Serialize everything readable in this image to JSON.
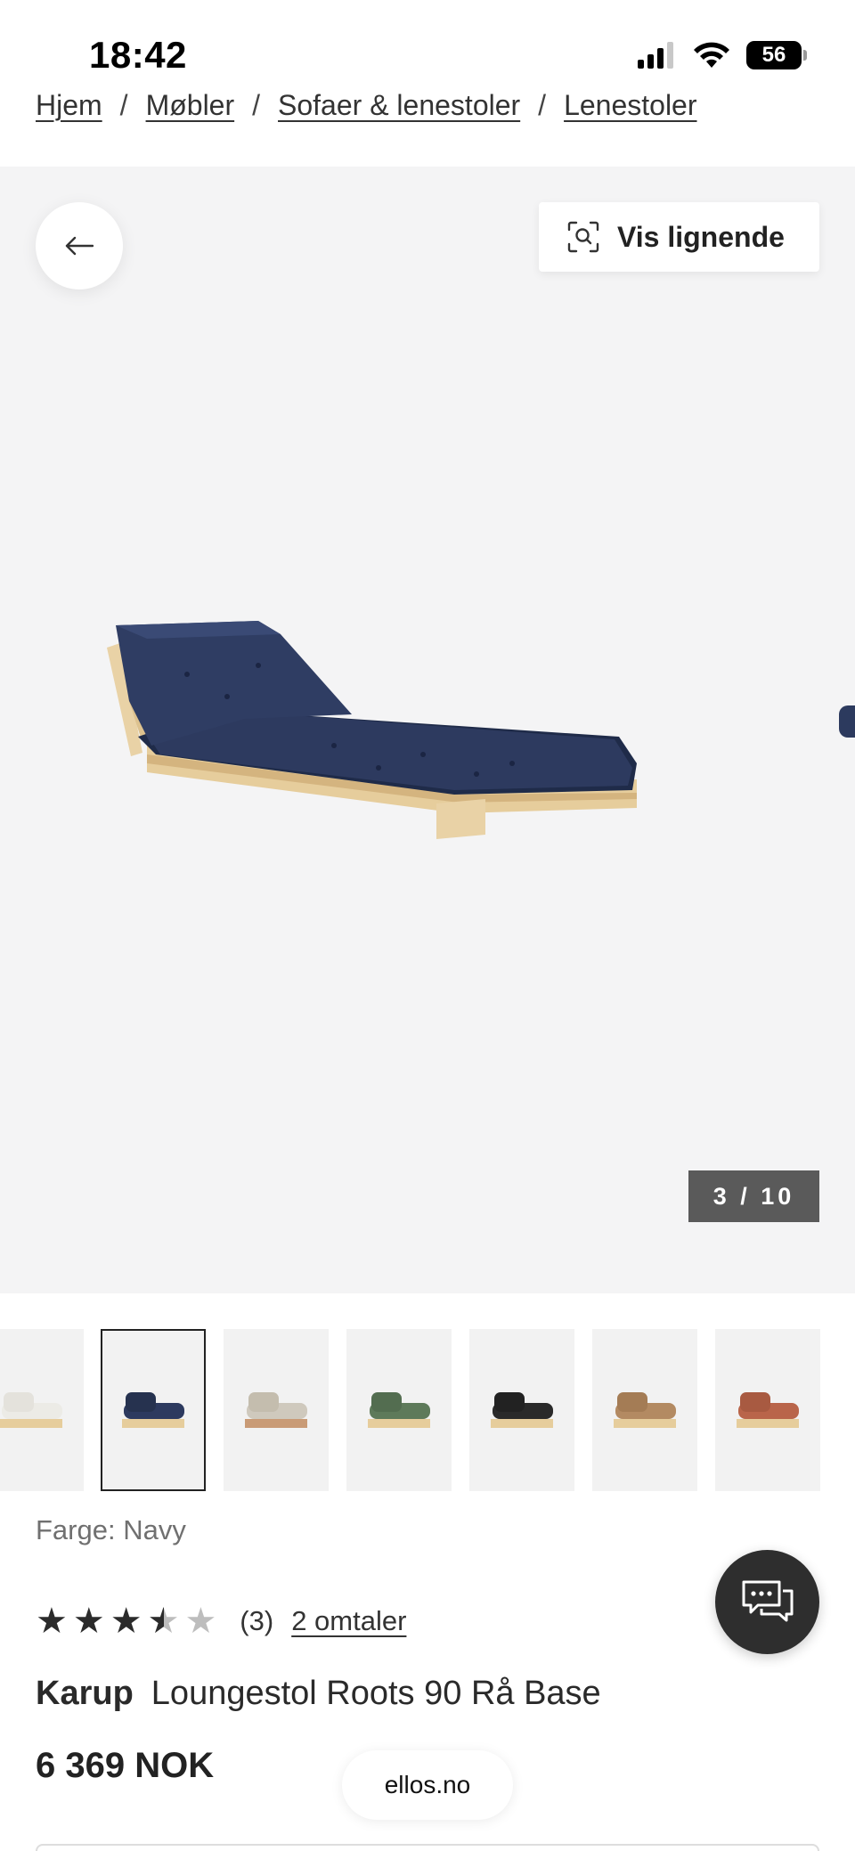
{
  "status": {
    "time": "18:42",
    "battery": "56"
  },
  "breadcrumb": [
    {
      "label": "Hjem"
    },
    {
      "label": "Møbler"
    },
    {
      "label": "Sofaer & lenestoler"
    },
    {
      "label": "Lenestoler"
    }
  ],
  "gallery": {
    "similar_label": "Vis lignende",
    "counter": "3 / 10",
    "current_index": 3,
    "total": 10
  },
  "thumbnails": [
    {
      "color": "#ecebe6",
      "name": "white"
    },
    {
      "color": "#2d3a5f",
      "name": "navy",
      "selected": true
    },
    {
      "color": "#cfc9bd",
      "name": "beige"
    },
    {
      "color": "#5e7a5a",
      "name": "green"
    },
    {
      "color": "#2a2a2a",
      "name": "black"
    },
    {
      "color": "#b38a62",
      "name": "brown"
    },
    {
      "color": "#b9654a",
      "name": "rust"
    }
  ],
  "product": {
    "color_label": "Farge: Navy",
    "rating": 3.5,
    "rating_count": "(3)",
    "reviews_link": "2 omtaler",
    "brand": "Karup",
    "name": "Loungestol Roots 90 Rå Base",
    "price": "6 369 NOK"
  },
  "footer": {
    "domain": "ellos.no"
  },
  "colors": {
    "mattress": "#2d3a5f",
    "wood": "#e9d2a6",
    "gallery_bg": "#f4f4f5",
    "counter_bg": "#5a5a5a",
    "chat_bg": "#2e2e2e"
  }
}
